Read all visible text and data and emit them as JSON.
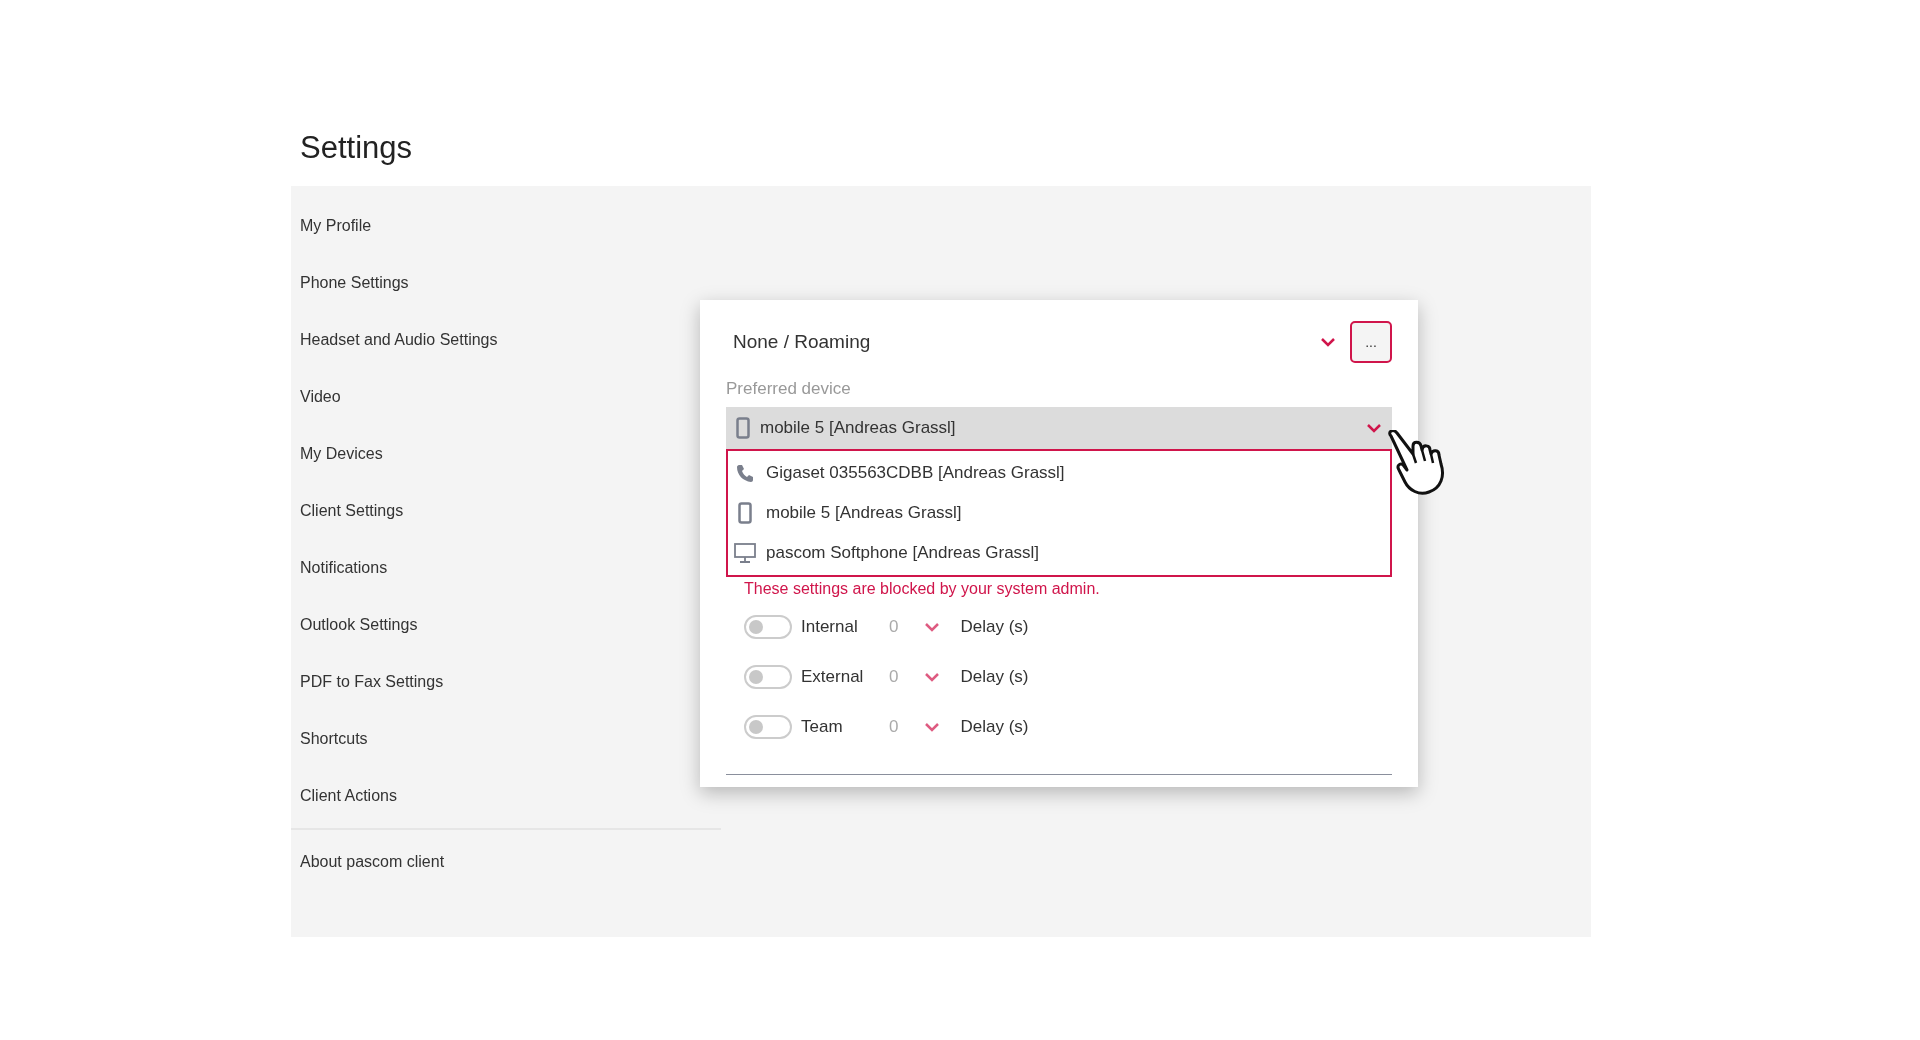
{
  "title": "Settings",
  "sidebar": {
    "items": [
      {
        "label": "My Profile"
      },
      {
        "label": "Phone Settings"
      },
      {
        "label": "Headset and Audio Settings"
      },
      {
        "label": "Video"
      },
      {
        "label": "My Devices"
      },
      {
        "label": "Client Settings"
      },
      {
        "label": "Notifications"
      },
      {
        "label": "Outlook Settings"
      },
      {
        "label": "PDF to Fax Settings"
      },
      {
        "label": "Shortcuts"
      },
      {
        "label": "Client Actions"
      }
    ],
    "footer_items": [
      {
        "label": "About pascom client"
      }
    ]
  },
  "panel": {
    "mode_select": {
      "value": "None / Roaming"
    },
    "more_button": "...",
    "preferred_device": {
      "label": "Preferred device",
      "value": "mobile 5 [Andreas Grassl]",
      "kind": "mobile",
      "expanded": true,
      "options": [
        {
          "label": "Gigaset 035563CDBB [Andreas Grassl]",
          "kind": "phone"
        },
        {
          "label": "mobile 5 [Andreas Grassl]",
          "kind": "mobile"
        },
        {
          "label": "pascom Softphone [Andreas Grassl]",
          "kind": "desktop"
        }
      ]
    },
    "notice": "These settings are blocked by your system admin.",
    "rules": [
      {
        "label": "Internal",
        "on": false,
        "delay": "0",
        "unit": "Delay (s)"
      },
      {
        "label": "External",
        "on": false,
        "delay": "0",
        "unit": "Delay (s)"
      },
      {
        "label": "Team",
        "on": false,
        "delay": "0",
        "unit": "Delay (s)"
      }
    ]
  }
}
